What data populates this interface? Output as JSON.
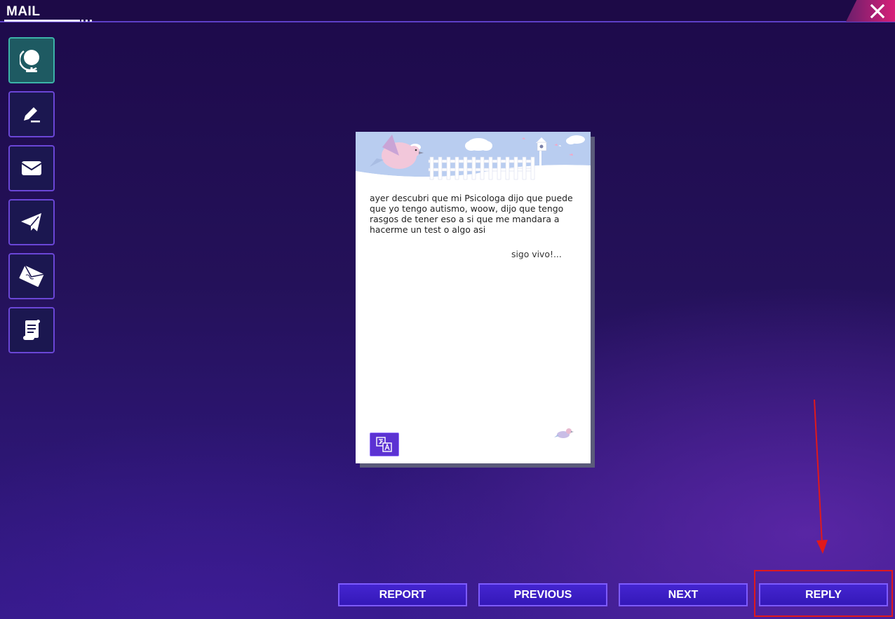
{
  "window": {
    "title": "MAIL"
  },
  "sidebar": {
    "items": [
      {
        "icon": "globe-icon",
        "active": true
      },
      {
        "icon": "pen-icon",
        "active": false
      },
      {
        "icon": "envelope-icon",
        "active": false
      },
      {
        "icon": "paper-plane-icon",
        "active": false
      },
      {
        "icon": "letter-icon",
        "active": false
      },
      {
        "icon": "scroll-icon",
        "active": false
      }
    ]
  },
  "letter": {
    "body": "ayer descubri que mi Psicologa dijo que puede que yo tengo autismo, woow, dijo que tengo rasgos de tener eso a si que me mandara a hacerme un test o algo asi",
    "signature": "sigo vivo!...",
    "translate_icon": "translate-icon"
  },
  "actions": {
    "report_label": "REPORT",
    "previous_label": "PREVIOUS",
    "next_label": "NEXT",
    "reply_label": "REPLY"
  },
  "colors": {
    "accent": "#5b32d2",
    "active_tab": "#1e5a62",
    "close_button": "#d81f78",
    "annotation": "#e0191c"
  }
}
